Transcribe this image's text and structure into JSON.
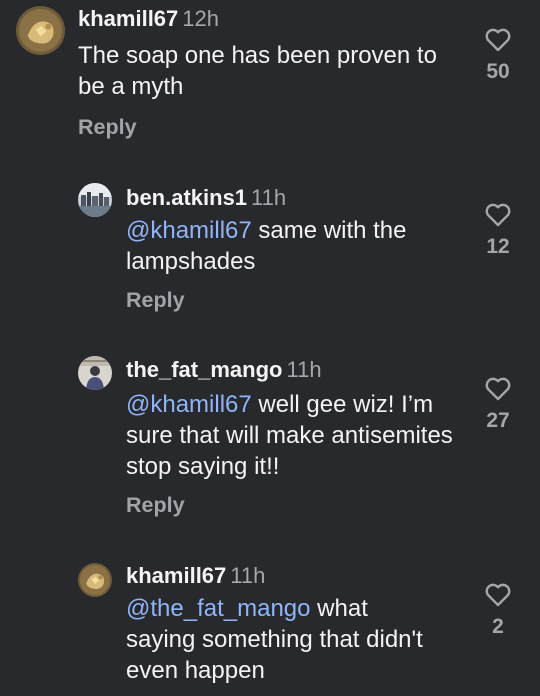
{
  "comments": [
    {
      "username": "khamill67",
      "time": "12h",
      "mention": "",
      "text": "The soap one has been proven to be a myth",
      "reply_label": "Reply",
      "likes": "50",
      "avatar": "khamill-avatar-icon"
    },
    {
      "username": "ben.atkins1",
      "time": "11h",
      "mention": "@khamill67",
      "text": " same with the lampshades",
      "reply_label": "Reply",
      "likes": "12",
      "avatar": "city-avatar-icon"
    },
    {
      "username": "the_fat_mango",
      "time": "11h",
      "mention": "@khamill67",
      "text": " well gee wiz! I’m sure that will make antisemites stop saying it!!",
      "reply_label": "Reply",
      "likes": "27",
      "avatar": "person-avatar-icon"
    },
    {
      "username": "khamill67",
      "time": "11h",
      "mention": "@the_fat_mango",
      "text": " what saying something that didn't even happen",
      "reply_label": "",
      "likes": "2",
      "avatar": "khamill-avatar-icon"
    }
  ],
  "colors": {
    "background": "#28292d",
    "mention": "#8fb5f8",
    "secondary_text": "#a6a7ab"
  }
}
